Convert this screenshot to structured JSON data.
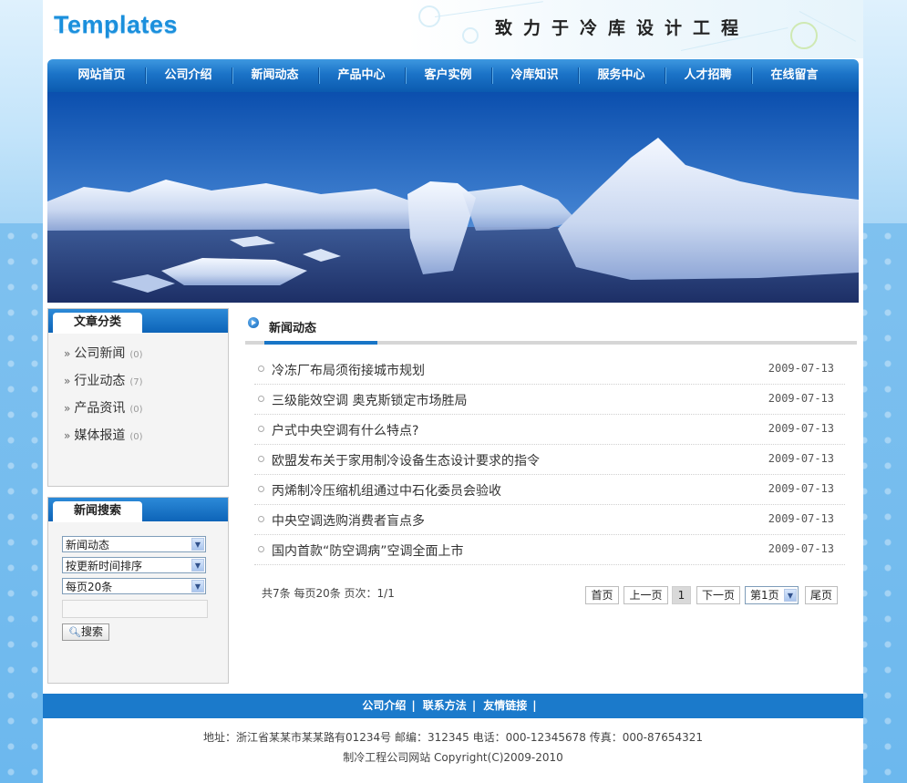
{
  "header": {
    "logo": "Templates",
    "slogan": "致力于冷库设计工程"
  },
  "nav": [
    "网站首页",
    "公司介绍",
    "新闻动态",
    "产品中心",
    "客户实例",
    "冷库知识",
    "服务中心",
    "人才招聘",
    "在线留言"
  ],
  "sidebar": {
    "categories_title": "文章分类",
    "categories": [
      {
        "label": "公司新闻",
        "count": "(0)"
      },
      {
        "label": "行业动态",
        "count": "(7)"
      },
      {
        "label": "产品资讯",
        "count": "(0)"
      },
      {
        "label": "媒体报道",
        "count": "(0)"
      }
    ],
    "search_title": "新闻搜索",
    "search": {
      "category": "新闻动态",
      "sort": "按更新时间排序",
      "per_page": "每页20条",
      "keyword": "",
      "button": "搜索"
    }
  },
  "main": {
    "title": "新闻动态",
    "news": [
      {
        "title": "冷冻厂布局须衔接城市规划",
        "date": "2009-07-13"
      },
      {
        "title": "三级能效空调  奥克斯锁定市场胜局",
        "date": "2009-07-13"
      },
      {
        "title": "户式中央空调有什么特点?",
        "date": "2009-07-13"
      },
      {
        "title": "欧盟发布关于家用制冷设备生态设计要求的指令",
        "date": "2009-07-13"
      },
      {
        "title": "丙烯制冷压缩机组通过中石化委员会验收",
        "date": "2009-07-13"
      },
      {
        "title": "中央空调选购消费者盲点多",
        "date": "2009-07-13"
      },
      {
        "title": "国内首款“防空调病”空调全面上市",
        "date": "2009-07-13"
      }
    ],
    "pager": {
      "info": "共7条  每页20条  页次：1/1",
      "first": "首页",
      "prev": "上一页",
      "current": "1",
      "next": "下一页",
      "jump": "第1页",
      "last": "尾页"
    }
  },
  "footer": {
    "links": [
      "公司介绍",
      "联系方法",
      "友情链接"
    ],
    "address": "地址：浙江省某某市某某路有01234号 邮编：312345 电话：000-12345678 传真：000-87654321",
    "copyright": "制冷工程公司网站 Copyright(C)2009-2010"
  },
  "colors": {
    "accent": "#1b7acb",
    "nav": "#0b5aaf",
    "logo": "#1a8fdc"
  }
}
